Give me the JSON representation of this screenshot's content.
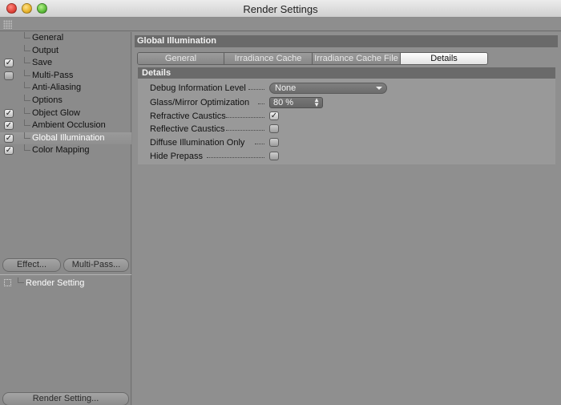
{
  "window": {
    "title": "Render Settings"
  },
  "sidebar": {
    "items": [
      {
        "label": "General",
        "checkbox": null,
        "selected": false
      },
      {
        "label": "Output",
        "checkbox": null,
        "selected": false
      },
      {
        "label": "Save",
        "checkbox": true,
        "selected": false
      },
      {
        "label": "Multi-Pass",
        "checkbox": false,
        "selected": false
      },
      {
        "label": "Anti-Aliasing",
        "checkbox": null,
        "selected": false
      },
      {
        "label": "Options",
        "checkbox": null,
        "selected": false
      },
      {
        "label": "Object Glow",
        "checkbox": true,
        "selected": false
      },
      {
        "label": "Ambient Occlusion",
        "checkbox": true,
        "selected": false
      },
      {
        "label": "Global Illumination",
        "checkbox": true,
        "selected": true
      },
      {
        "label": "Color Mapping",
        "checkbox": true,
        "selected": false
      }
    ],
    "effect_button": "Effect...",
    "multipass_button": "Multi-Pass...",
    "render_setting_item": "Render Setting",
    "render_setting_button": "Render Setting..."
  },
  "main": {
    "section_title": "Global Illumination",
    "tabs": [
      {
        "label": "General",
        "active": false
      },
      {
        "label": "Irradiance Cache",
        "active": false
      },
      {
        "label": "Irradiance Cache File",
        "active": false
      },
      {
        "label": "Details",
        "active": true
      }
    ],
    "details": {
      "title": "Details",
      "debug_label": "Debug Information Level",
      "debug_value": "None",
      "glass_label": "Glass/Mirror Optimization",
      "glass_value": "80 %",
      "refractive_label": "Refractive Caustics",
      "refractive_checked": true,
      "reflective_label": "Reflective Caustics",
      "reflective_checked": false,
      "diffuse_label": "Diffuse Illumination Only",
      "diffuse_checked": false,
      "hide_label": "Hide Prepass",
      "hide_checked": false
    }
  }
}
